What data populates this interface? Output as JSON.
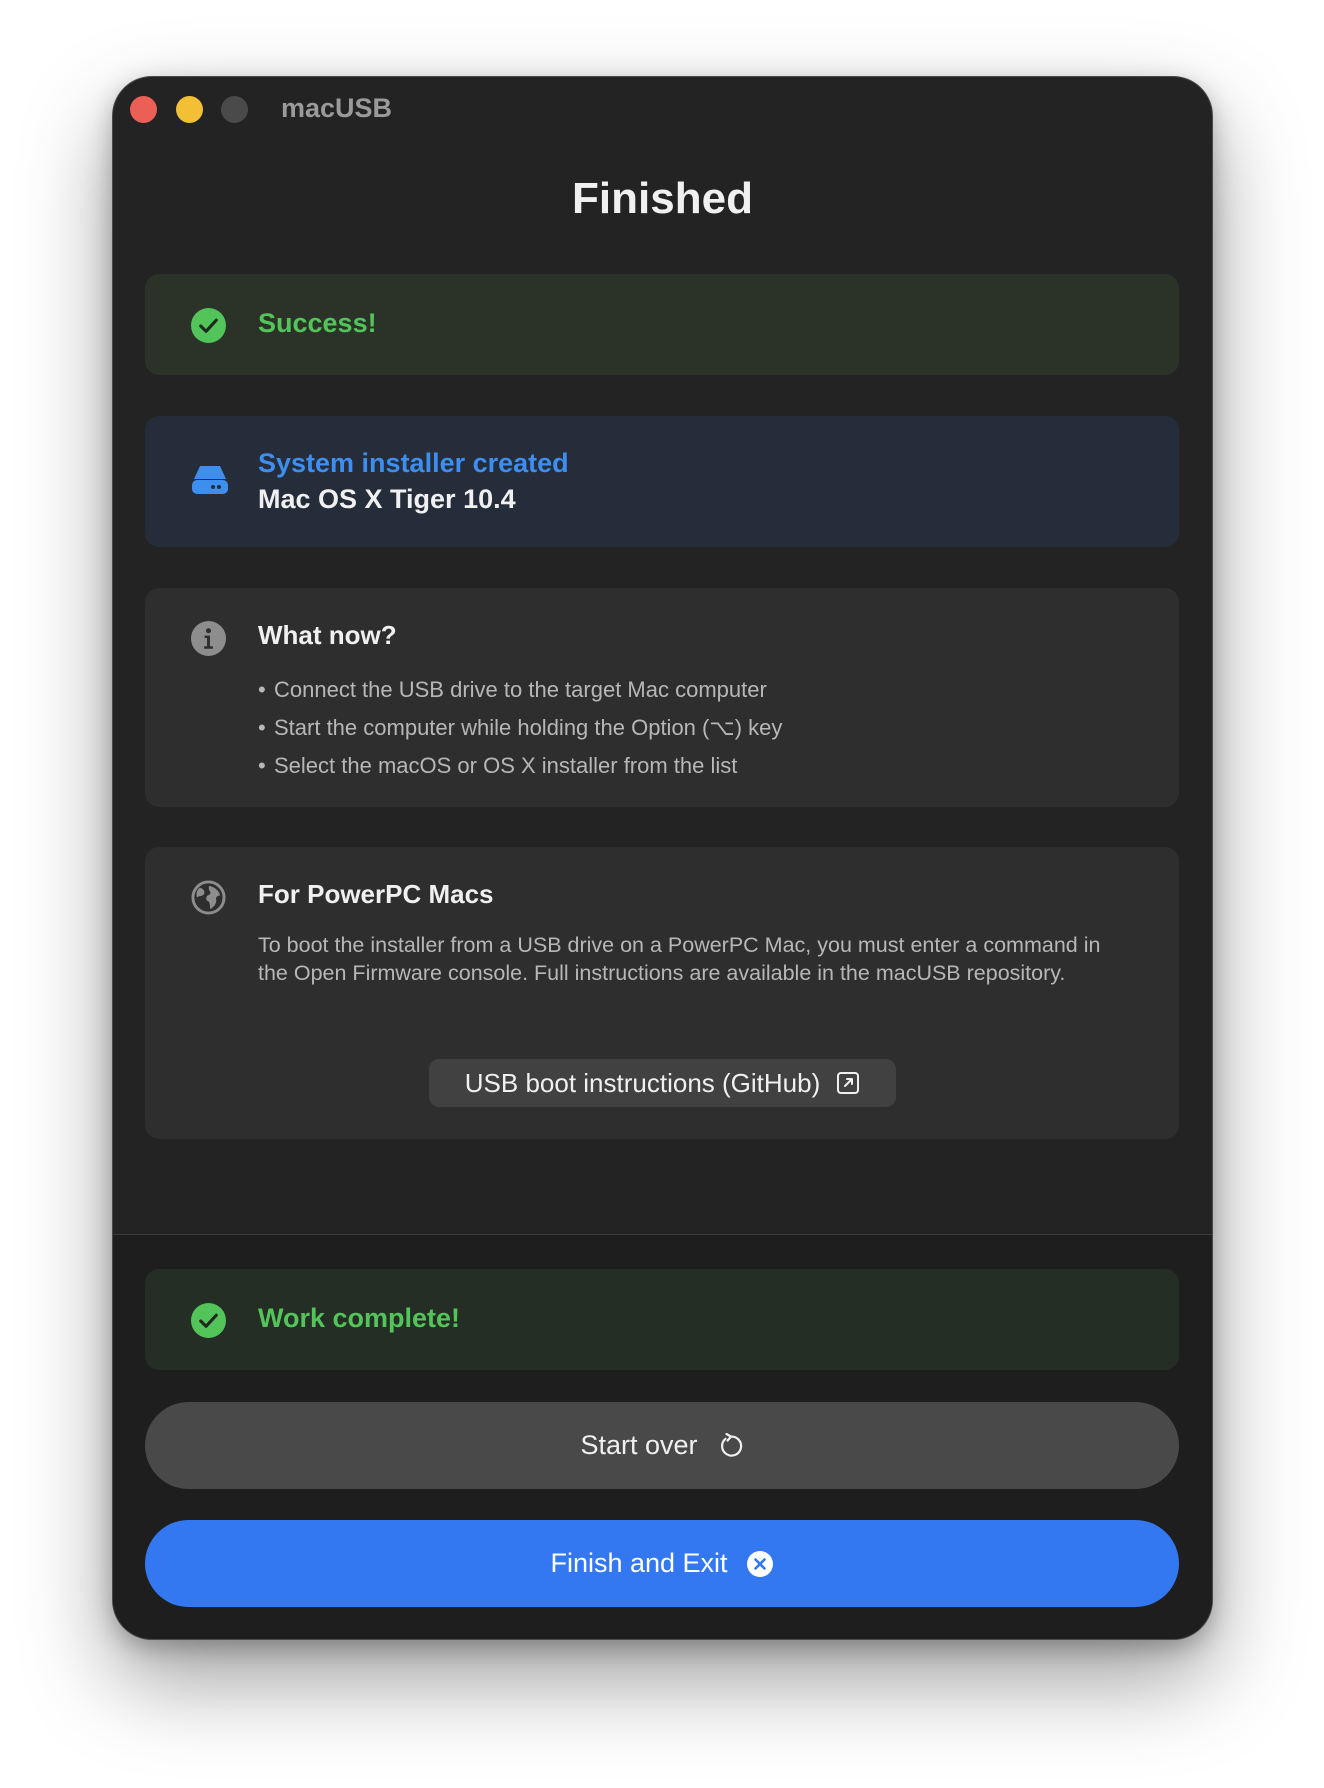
{
  "window": {
    "app_title": "macUSB"
  },
  "page": {
    "title": "Finished"
  },
  "success": {
    "label": "Success!",
    "icon": "checkmark-circle-icon"
  },
  "installer": {
    "label": "System installer created",
    "value": "Mac OS X Tiger 10.4",
    "icon": "drive-icon"
  },
  "what_now": {
    "heading": "What now?",
    "icon": "info-icon",
    "steps": [
      "Connect the USB drive to the target Mac computer",
      "Start the computer while holding the Option (⌥) key",
      "Select the macOS or OS X installer from the list"
    ]
  },
  "powerpc": {
    "heading": "For PowerPC Macs",
    "icon": "globe-icon",
    "description": "To boot the installer from a USB drive on a PowerPC Mac, you must enter a command in the Open Firmware console. Full instructions are available in the macUSB repository.",
    "link_label": "USB boot instructions (GitHub)",
    "link_icon": "external-link-icon"
  },
  "status": {
    "label": "Work complete!",
    "icon": "checkmark-circle-icon"
  },
  "actions": {
    "start_over_label": "Start over",
    "start_over_icon": "restart-icon",
    "finish_label": "Finish and Exit",
    "finish_icon": "close-circle-icon"
  },
  "colors": {
    "window_bg": "#232323",
    "success_green": "#53c45a",
    "accent_blue": "#3378f0",
    "installer_blue": "#3d8eef",
    "close_light": "#ec5f57",
    "minimize_light": "#f2bf35"
  }
}
